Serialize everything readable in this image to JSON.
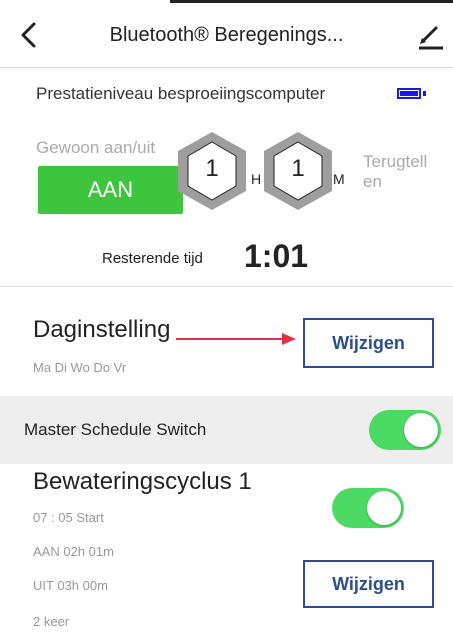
{
  "header": {
    "title": "Bluetooth® Beregenings...",
    "back_icon": "chevron-left-icon",
    "edit_icon": "pencil-icon"
  },
  "status": {
    "performance_label": "Prestatieniveau besproeiingscomputer",
    "battery_icon": "battery-full-icon",
    "battery_color": "#1a1ae6",
    "manual_label": "Gewoon aan/uit",
    "manual_button": "AAN",
    "manual_button_color": "#3ec53e",
    "hours_value": "1",
    "hours_unit": "H",
    "minutes_value": "1",
    "minutes_unit": "M",
    "countdown_label": "Terugtell en",
    "remaining_label": "Resterende tijd",
    "remaining_value": "1:01"
  },
  "day_setting": {
    "title": "Daginstelling",
    "days": "Ma Di Wo Do Vr",
    "button": "Wijzigen",
    "arrow_color": "#e0334a"
  },
  "master": {
    "label": "Master Schedule Switch",
    "enabled": true
  },
  "cycle": {
    "title": "Bewateringscyclus 1",
    "start": "07 : 05  Start",
    "on": "AAN 02h 01m",
    "off": "UIT 03h 00m",
    "repeat": "2 keer",
    "enabled": true,
    "button": "Wijzigen"
  },
  "colors": {
    "accent_blue": "#2c4e8c",
    "toggle_green": "#4cd964"
  }
}
